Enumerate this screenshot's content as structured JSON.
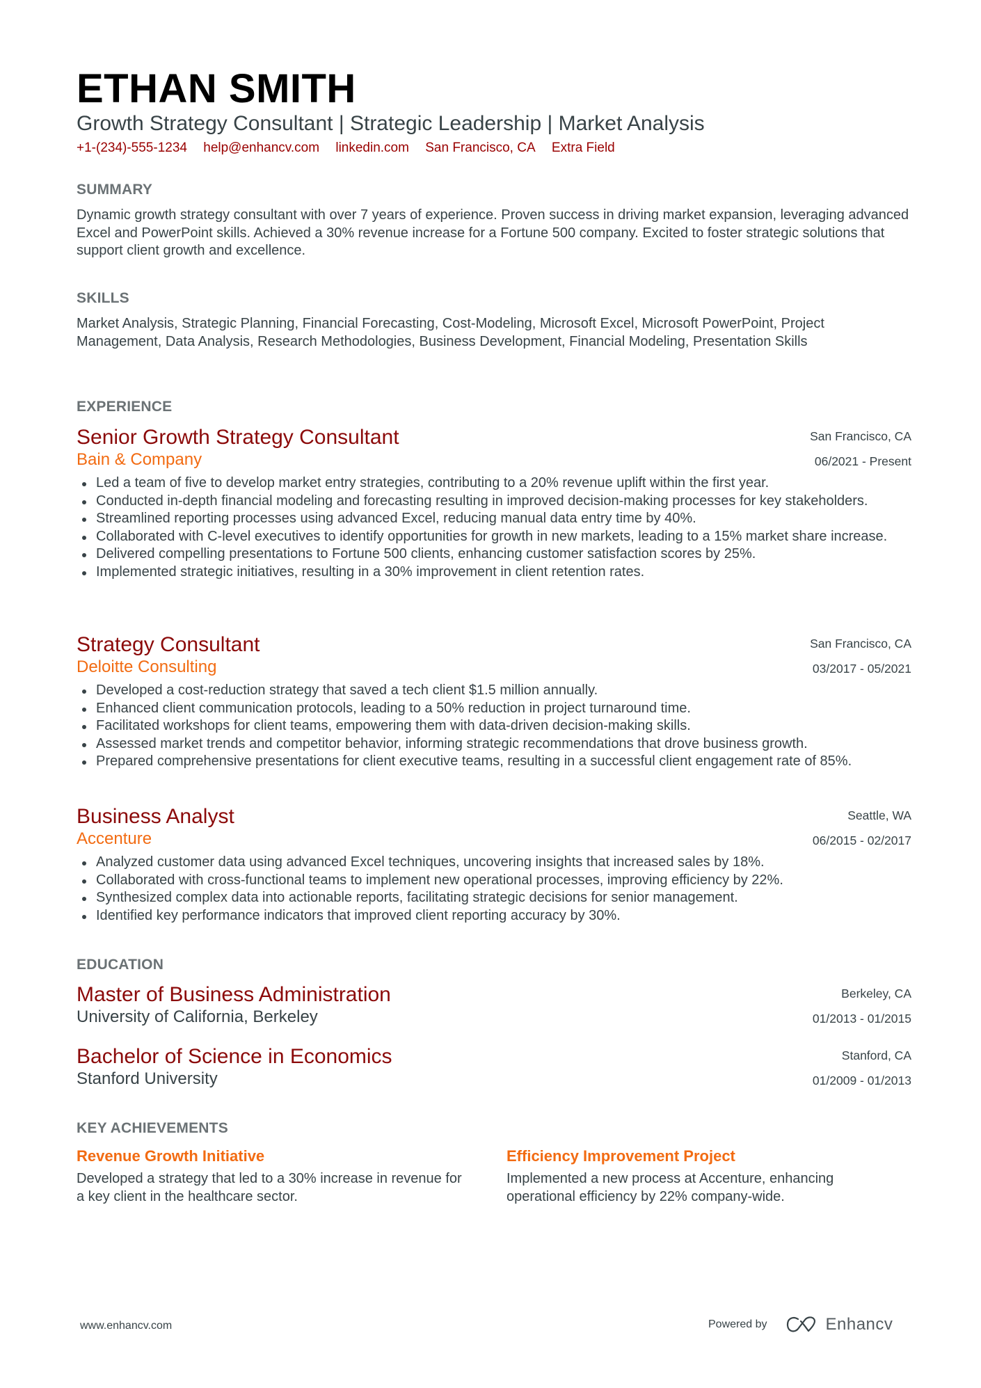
{
  "header": {
    "name": "ETHAN SMITH",
    "subtitle": "Growth Strategy Consultant | Strategic Leadership | Market Analysis",
    "contacts": [
      "+1-(234)-555-1234",
      "help@enhancv.com",
      "linkedin.com",
      "San Francisco, CA",
      "Extra Field"
    ]
  },
  "summary": {
    "heading": "SUMMARY",
    "text": "Dynamic growth strategy consultant with over 7 years of experience. Proven success in driving market expansion, leveraging advanced Excel and PowerPoint skills. Achieved a 30% revenue increase for a Fortune 500 company. Excited to foster strategic solutions that support client growth and excellence."
  },
  "skills": {
    "heading": "SKILLS",
    "text": "Market Analysis, Strategic Planning, Financial Forecasting, Cost-Modeling, Microsoft Excel, Microsoft PowerPoint, Project Management, Data Analysis, Research Methodologies, Business Development, Financial Modeling, Presentation Skills"
  },
  "experience": {
    "heading": "EXPERIENCE",
    "jobs": [
      {
        "title": "Senior Growth Strategy Consultant",
        "company": "Bain & Company",
        "location": "San Francisco, CA",
        "dates": "06/2021 - Present",
        "bullets": [
          "Led a team of five to develop market entry strategies, contributing to a 20% revenue uplift within the first year.",
          "Conducted in-depth financial modeling and forecasting resulting in improved decision-making processes for key stakeholders.",
          "Streamlined reporting processes using advanced Excel, reducing manual data entry time by 40%.",
          "Collaborated with C-level executives to identify opportunities for growth in new markets, leading to a 15% market share increase.",
          "Delivered compelling presentations to Fortune 500 clients, enhancing customer satisfaction scores by 25%.",
          "Implemented strategic initiatives, resulting in a 30% improvement in client retention rates."
        ]
      },
      {
        "title": "Strategy Consultant",
        "company": "Deloitte Consulting",
        "location": "San Francisco, CA",
        "dates": "03/2017 - 05/2021",
        "bullets": [
          "Developed a cost-reduction strategy that saved a tech client $1.5 million annually.",
          "Enhanced client communication protocols, leading to a 50% reduction in project turnaround time.",
          "Facilitated workshops for client teams, empowering them with data-driven decision-making skills.",
          "Assessed market trends and competitor behavior, informing strategic recommendations that drove business growth.",
          "Prepared comprehensive presentations for client executive teams, resulting in a successful client engagement rate of 85%."
        ]
      },
      {
        "title": "Business Analyst",
        "company": "Accenture",
        "location": "Seattle, WA",
        "dates": "06/2015 - 02/2017",
        "bullets": [
          "Analyzed customer data using advanced Excel techniques, uncovering insights that increased sales by 18%.",
          "Collaborated with cross-functional teams to implement new operational processes, improving efficiency by 22%.",
          "Synthesized complex data into actionable reports, facilitating strategic decisions for senior management.",
          "Identified key performance indicators that improved client reporting accuracy by 30%."
        ]
      }
    ]
  },
  "education": {
    "heading": "EDUCATION",
    "items": [
      {
        "degree": "Master of Business Administration",
        "school": "University of California, Berkeley",
        "location": "Berkeley, CA",
        "dates": "01/2013 - 01/2015"
      },
      {
        "degree": "Bachelor of Science in Economics",
        "school": "Stanford University",
        "location": "Stanford, CA",
        "dates": "01/2009 - 01/2013"
      }
    ]
  },
  "achievements": {
    "heading": "KEY ACHIEVEMENTS",
    "items": [
      {
        "title": "Revenue Growth Initiative",
        "description": "Developed a strategy that led to a 30% increase in revenue for a key client in the healthcare sector."
      },
      {
        "title": "Efficiency Improvement Project",
        "description": "Implemented a new process at Accenture, enhancing operational efficiency by 22% company-wide."
      }
    ]
  },
  "footer": {
    "website": "www.enhancv.com",
    "powered_by": "Powered by",
    "brand": "Enhancv",
    "logo_icon": "enhancv-logo-icon"
  },
  "colors": {
    "title_red": "#8b0a0a",
    "accent_orange": "#f26b12",
    "contact_red": "#990000",
    "heading_gray": "#6b7275",
    "body_text": "#384347"
  }
}
